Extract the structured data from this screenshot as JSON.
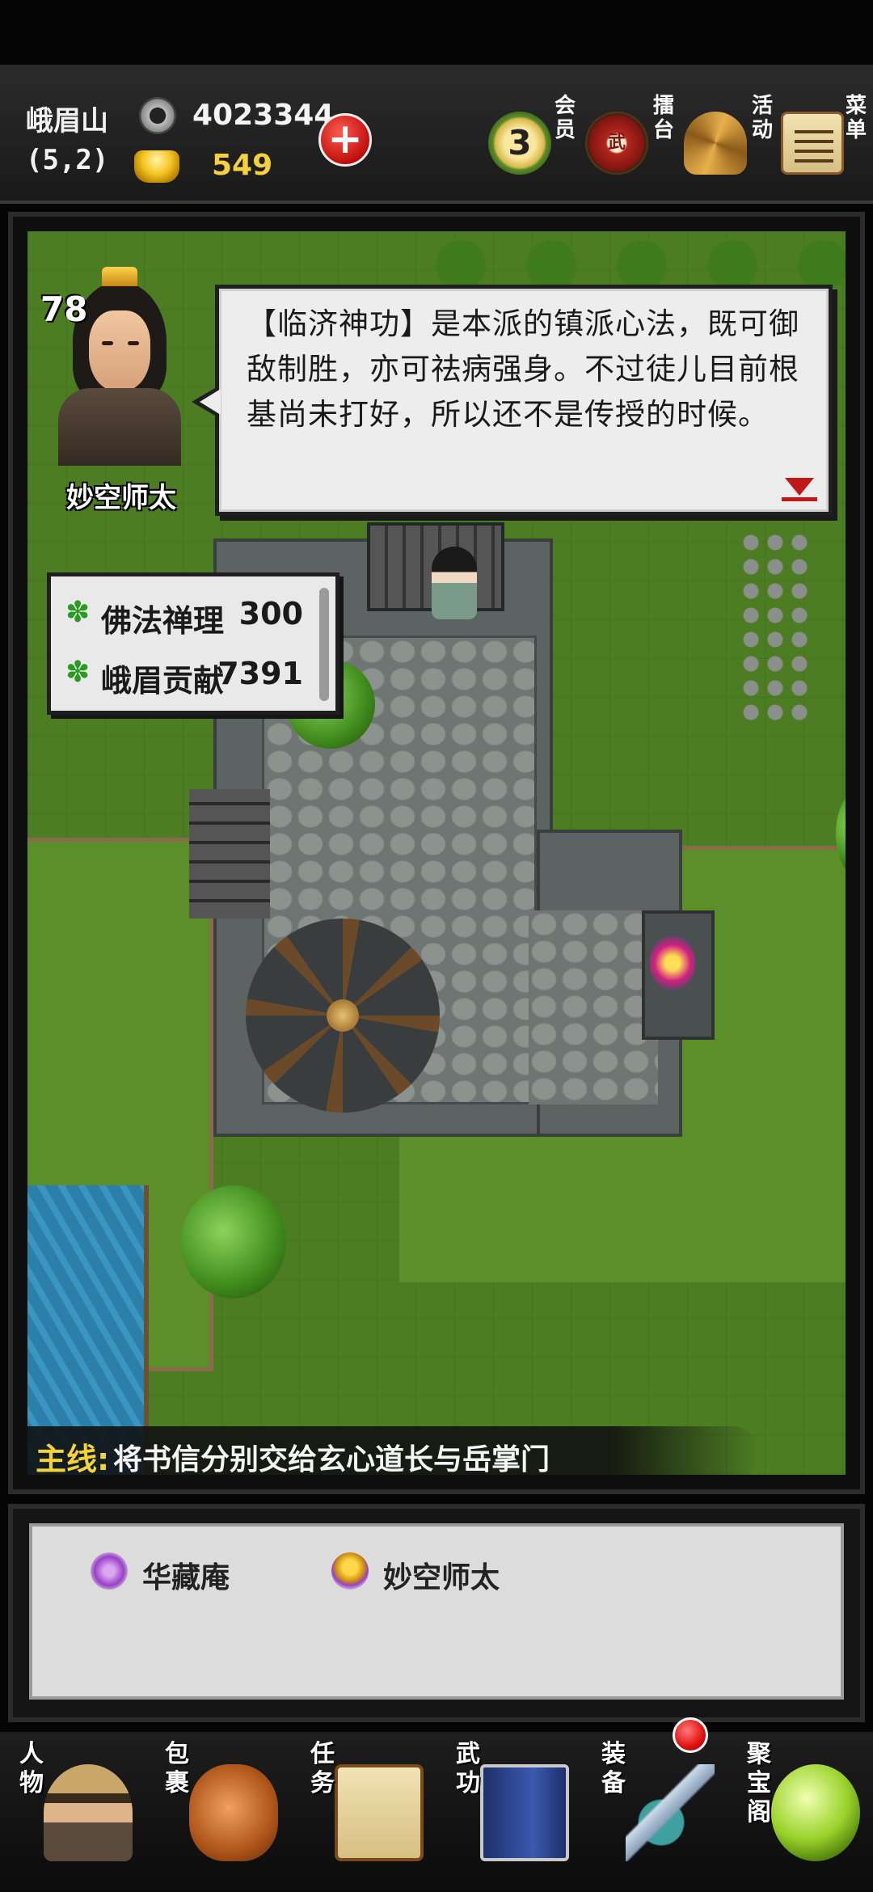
{
  "header": {
    "location_name": "峨眉山",
    "coordinates": "(5,2)",
    "silver": "4023344",
    "gold": "549",
    "add_label": "+",
    "buttons": [
      {
        "label": "会员",
        "badge": "3",
        "icon": "vip-badge-icon"
      },
      {
        "label": "擂台",
        "badge": "武",
        "icon": "drum-icon"
      },
      {
        "label": "活动",
        "icon": "straw-hat-icon"
      },
      {
        "label": "菜单",
        "icon": "scroll-icon"
      }
    ]
  },
  "npc": {
    "level": "78",
    "name": "妙空师太",
    "dialog": "【临济神功】是本派的镇派心法，既可御敌制胜，亦可祛病强身。不过徒儿目前根基尚未打好，所以还不是传授的时候。"
  },
  "stats": [
    {
      "name": "佛法禅理",
      "value": "300"
    },
    {
      "name": "峨眉贡献",
      "value": "7391"
    }
  ],
  "quest": {
    "tag": "主线",
    "separator": ":",
    "text": "将书信分别交给玄心道长与岳掌门"
  },
  "nearby": [
    {
      "label": "华藏庵",
      "icon": "building-icon"
    },
    {
      "label": "妙空师太",
      "icon": "npc-icon"
    }
  ],
  "nav": [
    {
      "label": "人物",
      "icon": "character-icon"
    },
    {
      "label": "包裹",
      "icon": "bag-icon"
    },
    {
      "label": "任务",
      "icon": "quest-scroll-icon"
    },
    {
      "label": "武功",
      "icon": "martial-book-icon"
    },
    {
      "label": "装备",
      "icon": "sword-icon"
    },
    {
      "label": "聚宝阁",
      "icon": "treasure-orb-icon"
    }
  ],
  "colors": {
    "gold_text": "#f6d13c",
    "quest_tag": "#f4d23a",
    "stat_icon": "#2a9a22",
    "alert_red": "#e01010"
  }
}
